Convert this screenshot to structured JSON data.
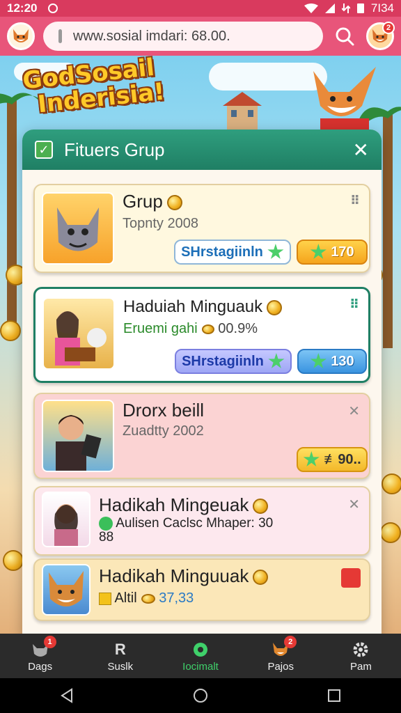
{
  "status_bar": {
    "time": "12:20",
    "right_text": "7I34"
  },
  "browser": {
    "url": "www.sosial imdari: 68.00.",
    "avatar_badge": "2"
  },
  "banner": {
    "logo_line1": "GodSosail",
    "logo_line2": "Inderisia!"
  },
  "panel": {
    "title": "Fituers Grup",
    "close_label": "✕"
  },
  "cards": [
    {
      "title": "Grup",
      "subtitle": "Topnty 2008",
      "button_label": "SHrstagiinln",
      "reward": "170"
    },
    {
      "title": "Haduiah Minguauk",
      "subtitle": "Eruemi gahi",
      "subtitle_extra": "00.9%",
      "button_label": "SHrstagiinln",
      "reward": "130"
    },
    {
      "title": "Drorx beill",
      "subtitle": "Zuadtty 2002",
      "reward": "≢90.."
    },
    {
      "title": "Hadikah Mingeuak",
      "subtitle_line1": "Aulisen Caclsc Mhaper: 30",
      "subtitle_line2": "88"
    },
    {
      "title": "Hadikah Minguuak",
      "subtitle": "Altil",
      "subtitle_extra": "37,33"
    }
  ],
  "bottom_nav": [
    {
      "label": "Dags",
      "badge": "1"
    },
    {
      "label": "Suslk"
    },
    {
      "label": "Iocimalt"
    },
    {
      "label": "Pajos",
      "badge": "2"
    },
    {
      "label": "Pam"
    }
  ],
  "colors": {
    "accent": "#e8557a",
    "panel_header": "#1f7f64",
    "active_nav": "#3fd06a"
  },
  "icons": [
    "fox-avatar-icon",
    "search-icon",
    "check-icon",
    "close-icon",
    "star-icon",
    "coin-icon",
    "drag-handle-icon",
    "gear-icon",
    "back-icon",
    "home-icon",
    "recents-icon"
  ]
}
